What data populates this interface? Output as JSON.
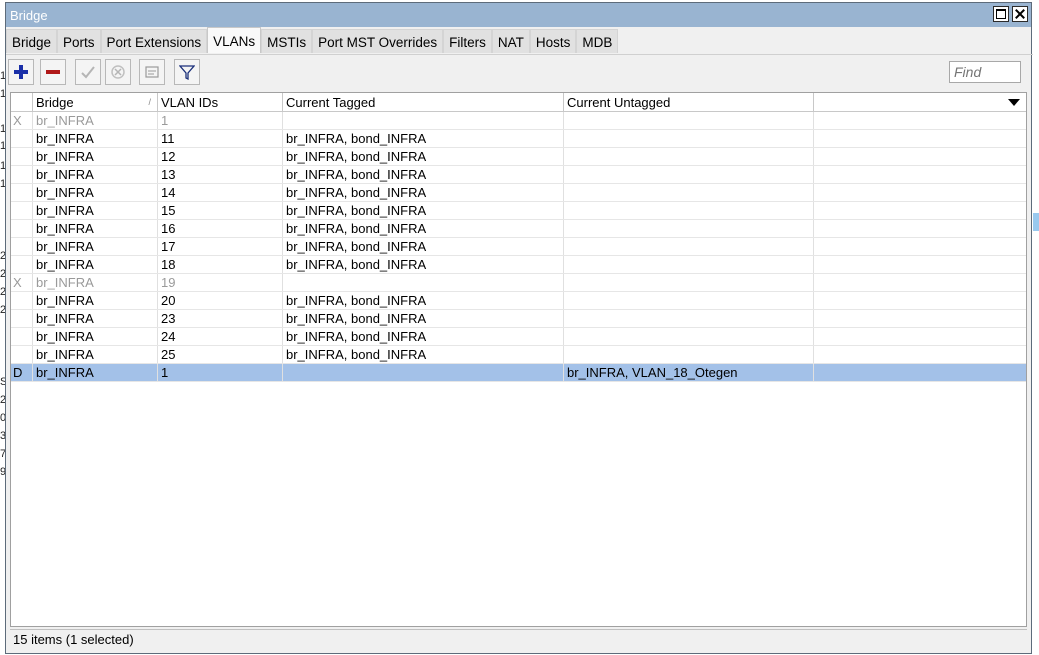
{
  "window": {
    "title": "Bridge"
  },
  "tabs": [
    {
      "label": "Bridge",
      "active": false
    },
    {
      "label": "Ports",
      "active": false
    },
    {
      "label": "Port Extensions",
      "active": false
    },
    {
      "label": "VLANs",
      "active": true
    },
    {
      "label": "MSTIs",
      "active": false
    },
    {
      "label": "Port MST Overrides",
      "active": false
    },
    {
      "label": "Filters",
      "active": false
    },
    {
      "label": "NAT",
      "active": false
    },
    {
      "label": "Hosts",
      "active": false
    },
    {
      "label": "MDB",
      "active": false
    }
  ],
  "toolbar": {
    "tools": [
      {
        "name": "add-button",
        "icon": "plus-icon"
      },
      {
        "name": "remove-button",
        "icon": "minus-icon"
      },
      {
        "name": "enable-button",
        "icon": "check-icon"
      },
      {
        "name": "disable-button",
        "icon": "x-icon"
      },
      {
        "name": "comment-button",
        "icon": "note-icon"
      },
      {
        "name": "filter-button",
        "icon": "filter-icon"
      }
    ],
    "find_placeholder": "Find"
  },
  "table": {
    "columns": [
      "",
      "Bridge",
      "VLAN IDs",
      "Current Tagged",
      "Current Untagged",
      ""
    ],
    "sort_indicator": "/",
    "rows": [
      {
        "flag": "X",
        "bridge": "br_INFRA",
        "vlan": "1",
        "tagged": "",
        "untagged": "",
        "disabled": true,
        "selected": false
      },
      {
        "flag": "",
        "bridge": "br_INFRA",
        "vlan": "11",
        "tagged": "br_INFRA, bond_INFRA",
        "untagged": "",
        "disabled": false,
        "selected": false
      },
      {
        "flag": "",
        "bridge": "br_INFRA",
        "vlan": "12",
        "tagged": "br_INFRA, bond_INFRA",
        "untagged": "",
        "disabled": false,
        "selected": false
      },
      {
        "flag": "",
        "bridge": "br_INFRA",
        "vlan": "13",
        "tagged": "br_INFRA, bond_INFRA",
        "untagged": "",
        "disabled": false,
        "selected": false
      },
      {
        "flag": "",
        "bridge": "br_INFRA",
        "vlan": "14",
        "tagged": "br_INFRA, bond_INFRA",
        "untagged": "",
        "disabled": false,
        "selected": false
      },
      {
        "flag": "",
        "bridge": "br_INFRA",
        "vlan": "15",
        "tagged": "br_INFRA, bond_INFRA",
        "untagged": "",
        "disabled": false,
        "selected": false
      },
      {
        "flag": "",
        "bridge": "br_INFRA",
        "vlan": "16",
        "tagged": "br_INFRA, bond_INFRA",
        "untagged": "",
        "disabled": false,
        "selected": false
      },
      {
        "flag": "",
        "bridge": "br_INFRA",
        "vlan": "17",
        "tagged": "br_INFRA, bond_INFRA",
        "untagged": "",
        "disabled": false,
        "selected": false
      },
      {
        "flag": "",
        "bridge": "br_INFRA",
        "vlan": "18",
        "tagged": "br_INFRA, bond_INFRA",
        "untagged": "",
        "disabled": false,
        "selected": false
      },
      {
        "flag": "X",
        "bridge": "br_INFRA",
        "vlan": "19",
        "tagged": "",
        "untagged": "",
        "disabled": true,
        "selected": false
      },
      {
        "flag": "",
        "bridge": "br_INFRA",
        "vlan": "20",
        "tagged": "br_INFRA, bond_INFRA",
        "untagged": "",
        "disabled": false,
        "selected": false
      },
      {
        "flag": "",
        "bridge": "br_INFRA",
        "vlan": "23",
        "tagged": "br_INFRA, bond_INFRA",
        "untagged": "",
        "disabled": false,
        "selected": false
      },
      {
        "flag": "",
        "bridge": "br_INFRA",
        "vlan": "24",
        "tagged": "br_INFRA, bond_INFRA",
        "untagged": "",
        "disabled": false,
        "selected": false
      },
      {
        "flag": "",
        "bridge": "br_INFRA",
        "vlan": "25",
        "tagged": "br_INFRA, bond_INFRA",
        "untagged": "",
        "disabled": false,
        "selected": false
      },
      {
        "flag": "D",
        "bridge": "br_INFRA",
        "vlan": "1",
        "tagged": "",
        "untagged": "br_INFRA, VLAN_18_Otegen",
        "disabled": false,
        "selected": true
      }
    ]
  },
  "status": {
    "text": "15 items (1 selected)"
  },
  "background": {
    "left_marks": [
      "1",
      "1",
      "1",
      "1",
      "1",
      "1",
      "2",
      "2",
      "2",
      "2",
      "S",
      "2",
      "0",
      "3",
      "7",
      "9"
    ]
  }
}
